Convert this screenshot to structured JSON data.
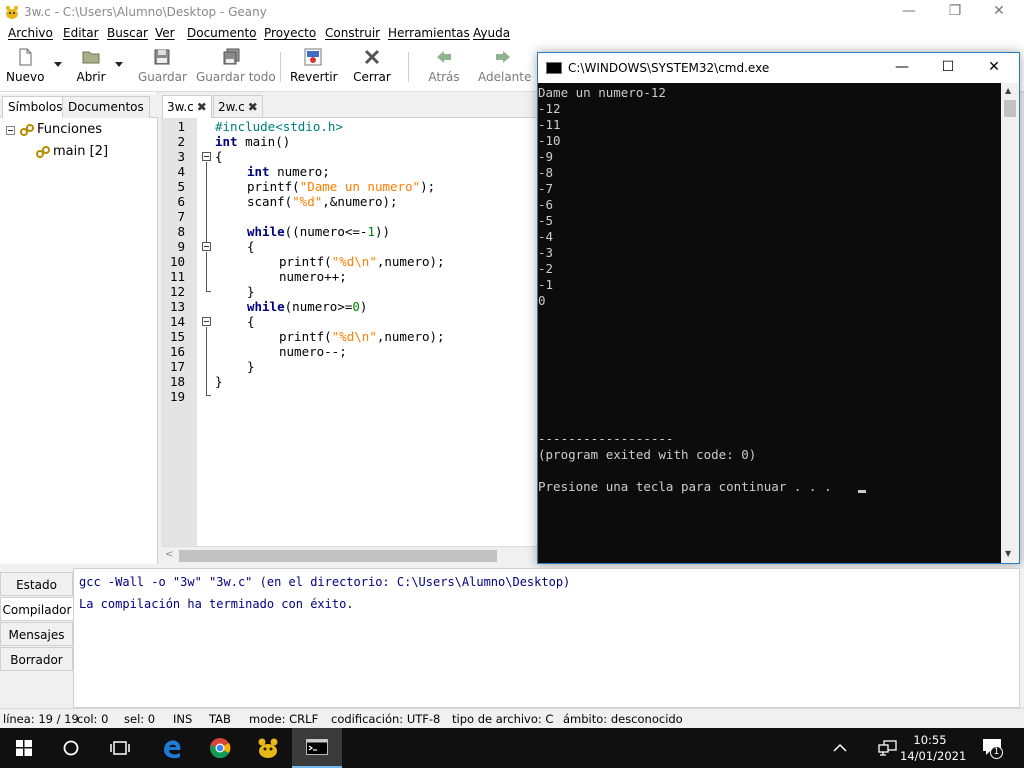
{
  "window": {
    "title": "3w.c - C:\\Users\\Alumno\\Desktop - Geany",
    "minimize": "—",
    "maximize": "❐",
    "close": "✕"
  },
  "menu": [
    "Archivo",
    "Editar",
    "Buscar",
    "Ver",
    "Documento",
    "Proyecto",
    "Construir",
    "Herramientas",
    "Ayuda"
  ],
  "toolbar": {
    "nuevo": "Nuevo",
    "abrir": "Abrir",
    "guardar": "Guardar",
    "guardar_todo": "Guardar todo",
    "revertir": "Revertir",
    "cerrar": "Cerrar",
    "atras": "Atrás",
    "adelante": "Adelante"
  },
  "sidebar": {
    "tabs": [
      "Símbolos",
      "Documentos"
    ],
    "tree": {
      "group": "Funciones",
      "item": "main [2]"
    }
  },
  "editor": {
    "tabs": [
      {
        "name": "3w.c",
        "close": "✖"
      },
      {
        "name": "2w.c",
        "close": "✖"
      }
    ],
    "line_numbers": [
      "1",
      "2",
      "3",
      "4",
      "5",
      "6",
      "7",
      "8",
      "9",
      "10",
      "11",
      "12",
      "13",
      "14",
      "15",
      "16",
      "17",
      "18",
      "19"
    ],
    "code": {
      "l1": "#include<stdio.h>",
      "l2_kw": "int",
      "l2_rest": " main()",
      "l3": "{",
      "l4_kw": "int",
      "l4_rest": " numero;",
      "l5_a": "printf(",
      "l5_str": "\"Dame un numero\"",
      "l5_b": ");",
      "l6_a": "scanf(",
      "l6_str": "\"%d\"",
      "l6_b": ",&numero);",
      "l8_kw": "while",
      "l8_a": "((numero<=-",
      "l8_num": "1",
      "l8_b": "))",
      "l9": "{",
      "l10_a": "printf(",
      "l10_str": "\"%d\\n\"",
      "l10_b": ",numero);",
      "l11": "numero++;",
      "l12": "}",
      "l13_kw": "while",
      "l13_a": "(numero>=",
      "l13_num": "0",
      "l13_b": ")",
      "l14": "{",
      "l15_a": "printf(",
      "l15_str": "\"%d\\n\"",
      "l15_b": ",numero);",
      "l16": "numero--;",
      "l17": "}",
      "l18": "}"
    }
  },
  "cmd": {
    "title": "C:\\WINDOWS\\SYSTEM32\\cmd.exe",
    "minimize": "—",
    "maximize": "☐",
    "close": "✕",
    "lines": [
      "Dame un numero-12",
      "-12",
      "-11",
      "-10",
      "-9",
      "-8",
      "-7",
      "-6",
      "-5",
      "-4",
      "-3",
      "-2",
      "-1",
      "0"
    ],
    "separator": "------------------",
    "exit_msg": "(program exited with code: 0)",
    "prompt": "Presione una tecla para continuar . . ."
  },
  "messages": {
    "tabs": [
      "Estado",
      "Compilador",
      "Mensajes",
      "Borrador"
    ],
    "active_tab": "Compilador",
    "lines": [
      "gcc -Wall -o \"3w\" \"3w.c\" (en el directorio: C:\\Users\\Alumno\\Desktop)",
      "La compilación ha terminado con éxito."
    ]
  },
  "status": {
    "linea": "línea: 19 / 19",
    "col": "col: 0",
    "sel": "sel: 0",
    "ins": "INS",
    "tab": "TAB",
    "mode": "mode: CRLF",
    "codificacion": "codificación: UTF-8",
    "tipo": "tipo de archivo: C",
    "ambito": "ámbito: desconocido"
  },
  "taskbar": {
    "time": "10:55",
    "date": "14/01/2021",
    "notification_count": "1"
  }
}
